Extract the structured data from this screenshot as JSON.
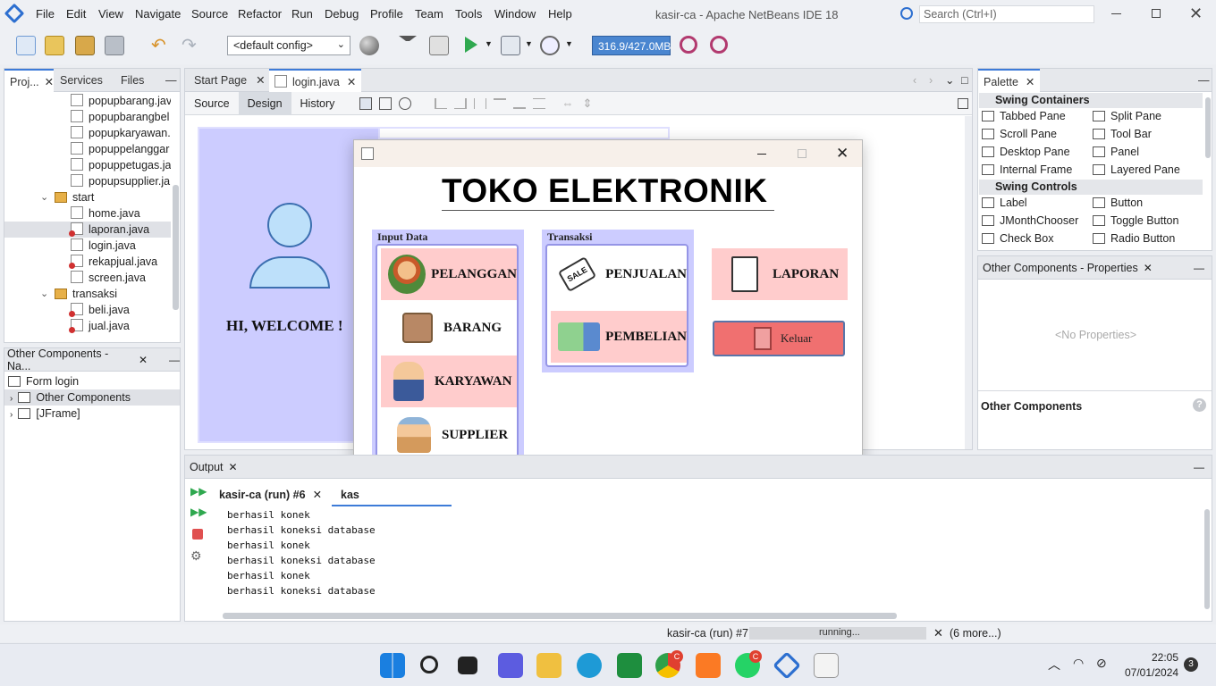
{
  "window": {
    "title": "kasir-ca - Apache NetBeans IDE 18",
    "search_placeholder": "Search (Ctrl+I)"
  },
  "menu": [
    "File",
    "Edit",
    "View",
    "Navigate",
    "Source",
    "Refactor",
    "Run",
    "Debug",
    "Profile",
    "Team",
    "Tools",
    "Window",
    "Help"
  ],
  "toolbar": {
    "config": "<default config>",
    "memory": "316.9/427.0MB"
  },
  "left_tabs": [
    "Proj...",
    "Services",
    "Files"
  ],
  "project_tree": {
    "files_top": [
      "popupbarang.jav",
      "popupbarangbel",
      "popupkaryawan.",
      "popuppelanggar",
      "popuppetugas.ja",
      "popupsupplier.ja"
    ],
    "pkg_start": "start",
    "start_files": [
      "home.java",
      "laporan.java",
      "login.java",
      "rekapjual.java",
      "screen.java"
    ],
    "pkg_transaksi": "transaksi",
    "transaksi_files": [
      "beli.java",
      "jual.java"
    ]
  },
  "navigator": {
    "title": "Other Components - Na...",
    "items": [
      "Form login",
      "Other Components",
      "[JFrame]"
    ]
  },
  "editor": {
    "tabs": [
      "Start Page",
      "login.java"
    ],
    "modes": [
      "Source",
      "Design",
      "History"
    ]
  },
  "form": {
    "welcome": "HI, WELCOME !",
    "heading": "TOKO ELEKTRONIK",
    "group_input": "Input Data",
    "group_trans": "Transaksi",
    "btn_pelanggan": "PELANGGAN",
    "btn_barang": "BARANG",
    "btn_karyawan": "KARYAWAN",
    "btn_supplier": "SUPPLIER",
    "btn_penjualan": "PENJUALAN",
    "btn_pembelian": "PEMBELIAN",
    "btn_laporan": "LAPORAN",
    "btn_keluar": "Keluar",
    "sale_tag": "SALE"
  },
  "palette": {
    "title": "Palette",
    "cat_containers": "Swing Containers",
    "containers": [
      "Tabbed Pane",
      "Split Pane",
      "Scroll Pane",
      "Tool Bar",
      "Desktop Pane",
      "Panel",
      "Internal Frame",
      "Layered Pane"
    ],
    "cat_controls": "Swing Controls",
    "controls": [
      "Label",
      "Button",
      "JMonthChooser",
      "Toggle Button",
      "Check Box",
      "Radio Button"
    ],
    "label_icon": "label",
    "ok_icon": "OK"
  },
  "properties": {
    "title": "Other Components - Properties",
    "empty": "<No Properties>",
    "footer": "Other Components"
  },
  "output": {
    "title": "Output",
    "tabs": [
      "kasir-ca (run) #6",
      "kas"
    ],
    "lines": [
      "berhasil konek",
      "berhasil koneksi database",
      "berhasil konek",
      "berhasil koneksi database",
      "berhasil konek",
      "berhasil koneksi database"
    ]
  },
  "status": {
    "run": "kasir-ca (run) #7",
    "progress": "running...",
    "more": "(6 more...)"
  },
  "taskbar": {
    "time": "22:05",
    "date": "07/01/2024",
    "badge": "3",
    "chrome_badge": "C",
    "wa_badge": "C"
  },
  "colors": {
    "accent": "#3d7bd8",
    "form_bg": "#ccccff",
    "btn_pink": "#ffcccc",
    "keluar": "#f07070"
  }
}
